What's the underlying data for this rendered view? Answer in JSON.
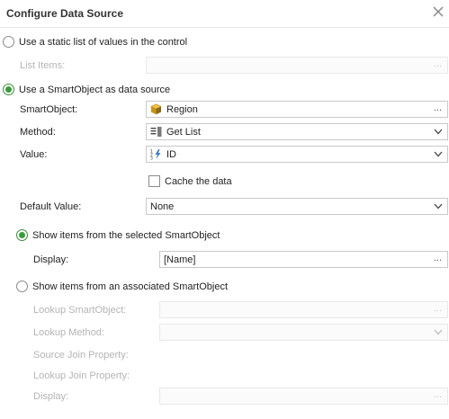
{
  "dialog": {
    "title": "Configure Data Source"
  },
  "static_option": {
    "label": "Use a static list of values in the control",
    "list_items_label": "List Items:",
    "list_items_button": "..."
  },
  "smartobject_option": {
    "label": "Use a SmartObject as data source",
    "smartobject_label": "SmartObject:",
    "smartobject_value": "Region",
    "smartobject_button": "...",
    "method_label": "Method:",
    "method_value": "Get List",
    "value_label": "Value:",
    "value_value": "ID",
    "cache_label": "Cache the data",
    "default_label": "Default Value:",
    "default_value": "None"
  },
  "selected_option": {
    "label": "Show items from the selected SmartObject",
    "display_label": "Display:",
    "display_value": "[Name]",
    "display_button": "..."
  },
  "associated_option": {
    "label": "Show items from an associated SmartObject",
    "lookup_smartobject_label": "Lookup SmartObject:",
    "lookup_smartobject_button": "...",
    "lookup_method_label": "Lookup Method:",
    "source_join_label": "Source Join Property:",
    "lookup_join_label": "Lookup Join Property:",
    "display_label": "Display:",
    "display_button": "..."
  },
  "colors": {
    "accent": "#3a9b3a",
    "disabled_text": "#b4b4b4",
    "border": "#c9c9c9"
  }
}
